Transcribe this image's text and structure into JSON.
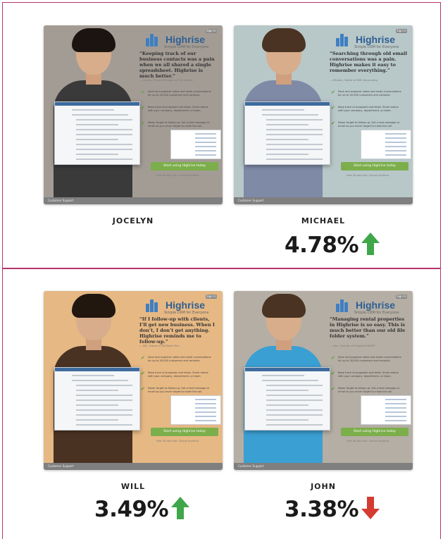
{
  "cards": [
    {
      "brand": "Highrise",
      "tagline": "Simple CRM for Everyone",
      "signin_label": "Sign In",
      "quote": "“Keeping track of our business contacts was a pain when we all shared a single spreadsheet. Highrise is much better.”",
      "attribution": "— Jocelyn, Project Manager at Fine Design",
      "features": [
        "Save and organize notes and email conversations for up to 30,000 customers and contacts.",
        "Keep track of proposals and deals. Share status with your company, department, or team.",
        "Never forget to follow-up. Get a text message or email so you never forget to make the call."
      ],
      "cta_label": "Start using Highrise today",
      "cta_note": "Free 30-day trial. Cancel anytime.",
      "footer": "Customer Support",
      "name": "JOCELYN",
      "bg": "#a39c95",
      "body_color": "#3a3a3a",
      "hair_color": "#1c1410"
    },
    {
      "brand": "Highrise",
      "tagline": "Simple CRM for Everyone",
      "signin_label": "Sign In",
      "quote": "“Searching through old email conversations was a pain. Highrise makes it easy to remember everything.”",
      "attribution": "— Michael, Owner of NMC Accounting",
      "features": [
        "Save and organize notes and email conversations for up to 30,000 customers and contacts.",
        "Keep track of proposals and deals. Share status with your company, department, or team.",
        "Never forget to follow-up. Get a text message or email so you never forget to make the call."
      ],
      "cta_label": "Start using Highrise today",
      "cta_note": "Free 30-day trial. Cancel anytime.",
      "footer": "Customer Support",
      "name": "MICHAEL",
      "metric": "4.78%",
      "direction": "up",
      "bg": "#b8c7c8",
      "body_color": "#7f8aa6",
      "hair_color": "#4a3322"
    },
    {
      "brand": "Highrise",
      "tagline": "Simple CRM for Everyone",
      "signin_label": "Sign In",
      "quote": "“If I follow-up with clients, I’ll get new business. When I don’t, I don’t get anything. Highrise reminds me to follow-up.”",
      "attribution": "— Will, Owner of Tall Tower Film",
      "features": [
        "Save and organize notes and email conversations for up to 30,000 customers and contacts.",
        "Keep track of proposals and deals. Share status with your company, department, or team.",
        "Never forget to follow-up. Get a text message or email so you never forget to make the call."
      ],
      "cta_label": "Start using Highrise today",
      "cta_note": "Free 30-day trial. Cancel anytime.",
      "footer": "Customer Support",
      "name": "WILL",
      "metric": "3.49%",
      "direction": "up",
      "bg": "#e6b884",
      "body_color": "#4a3222",
      "hair_color": "#22170f"
    },
    {
      "brand": "Highrise",
      "tagline": "Simple CRM for Everyone",
      "signin_label": "Sign In",
      "quote": "“Managing rental properties in Highrise is so easy. This is much better than our old file folder system.”",
      "attribution": "— John, Founder of Shepherd MGMT",
      "features": [
        "Save and organize notes and email conversations for up to 30,000 customers and contacts.",
        "Keep track of proposals and deals. Share status with your company, department, or team.",
        "Never forget to follow-up. Get a text message or email so you never forget to make the call."
      ],
      "cta_label": "Start using Highrise today",
      "cta_note": "Free 30-day trial. Cancel anytime.",
      "footer": "Customer Support",
      "name": "JOHN",
      "metric": "3.38%",
      "direction": "down",
      "bg": "#b5aea4",
      "body_color": "#3a9fd3",
      "hair_color": "#4a3322"
    }
  ],
  "colors": {
    "up_arrow": "#3fa64a",
    "down_arrow": "#d43b32",
    "frame": "#b5336a",
    "cta": "#7cae4b"
  }
}
